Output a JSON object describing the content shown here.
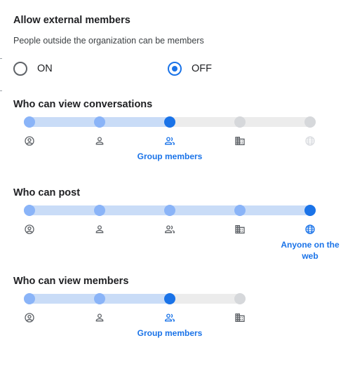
{
  "external": {
    "title": "Allow external members",
    "description": "People outside the organization can be members",
    "options": [
      {
        "label": "ON",
        "checked": false
      },
      {
        "label": "OFF",
        "checked": true
      }
    ]
  },
  "sliders": [
    {
      "title": "Who can view conversations",
      "selected_index": 2,
      "steps": [
        {
          "icon": "account-circle-icon",
          "caption": ""
        },
        {
          "icon": "person-icon",
          "caption": ""
        },
        {
          "icon": "group-icon",
          "caption": "Group members"
        },
        {
          "icon": "domain-icon",
          "caption": ""
        },
        {
          "icon": "globe-icon",
          "caption": "",
          "faded": true
        }
      ]
    },
    {
      "title": "Who can post",
      "selected_index": 4,
      "steps": [
        {
          "icon": "account-circle-icon",
          "caption": ""
        },
        {
          "icon": "person-icon",
          "caption": ""
        },
        {
          "icon": "group-icon",
          "caption": ""
        },
        {
          "icon": "domain-icon",
          "caption": ""
        },
        {
          "icon": "globe-icon",
          "caption": "Anyone on the web"
        }
      ]
    },
    {
      "title": "Who can view members",
      "selected_index": 2,
      "steps": [
        {
          "icon": "account-circle-icon",
          "caption": ""
        },
        {
          "icon": "person-icon",
          "caption": ""
        },
        {
          "icon": "group-icon",
          "caption": "Group members"
        },
        {
          "icon": "domain-icon",
          "caption": ""
        }
      ]
    }
  ],
  "colors": {
    "accent": "#1a73e8",
    "track_fill": "#c9dcf7",
    "track_empty": "#ececec",
    "dot_on": "#8ab4f8",
    "dot_off": "#d6d8db",
    "icon": "#5f6368",
    "icon_faded": "#dadce0"
  }
}
